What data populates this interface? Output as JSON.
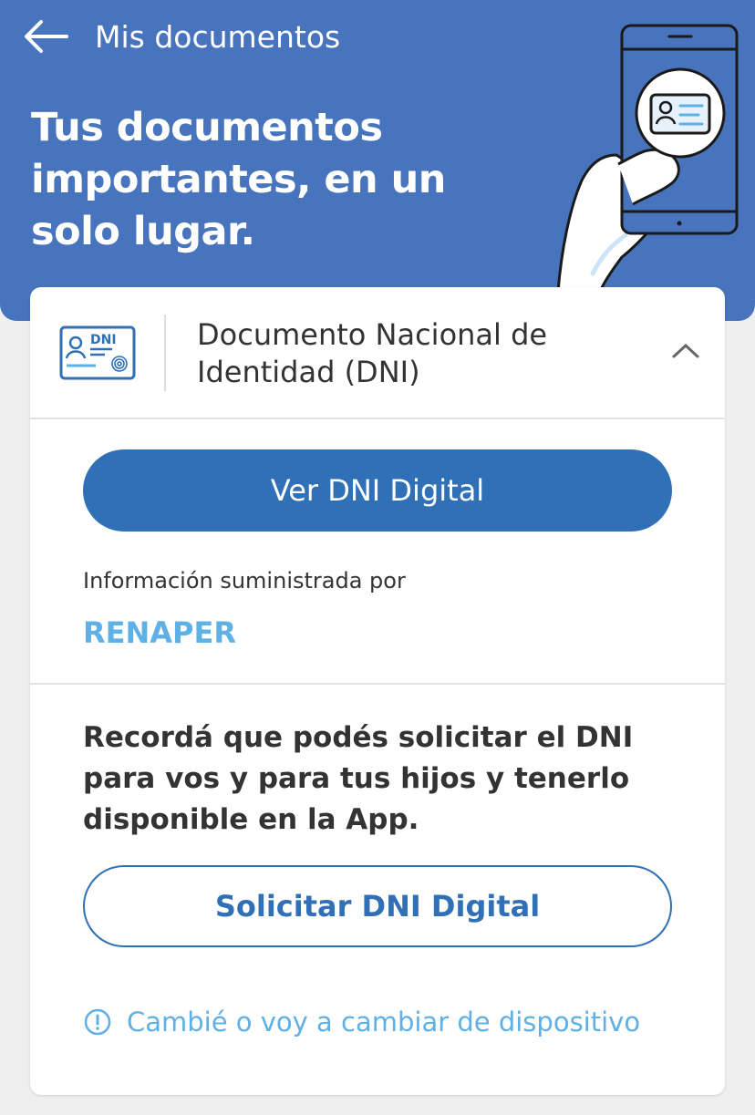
{
  "header": {
    "back_icon": "arrow-left-icon",
    "title": "Mis documentos",
    "hero_text": "Tus documentos importantes, en un solo lugar.",
    "background_color": "#4774bc",
    "illustration": "hand-holding-phone-with-id-card-icon"
  },
  "document_card": {
    "icon": "dni-card-icon",
    "icon_label": "DNI",
    "title": "Documento Nacional de Identidad (DNI)",
    "expand_icon": "chevron-up-icon",
    "primary_button_label": "Ver DNI Digital",
    "info_label": "Información suministrada por",
    "provider": "RENAPER",
    "reminder_text": "Recordá que podés solicitar el DNI para vos y para tus hijos y tenerlo disponible en la App.",
    "secondary_button_label": "Solicitar DNI Digital",
    "device_link_icon": "info-circle-icon",
    "device_link_text": "Cambié o voy a cambiar de dispositivo"
  },
  "colors": {
    "primary": "#3070b6",
    "accent_light": "#5fb0e4",
    "text": "#333333",
    "background": "#efefef"
  }
}
